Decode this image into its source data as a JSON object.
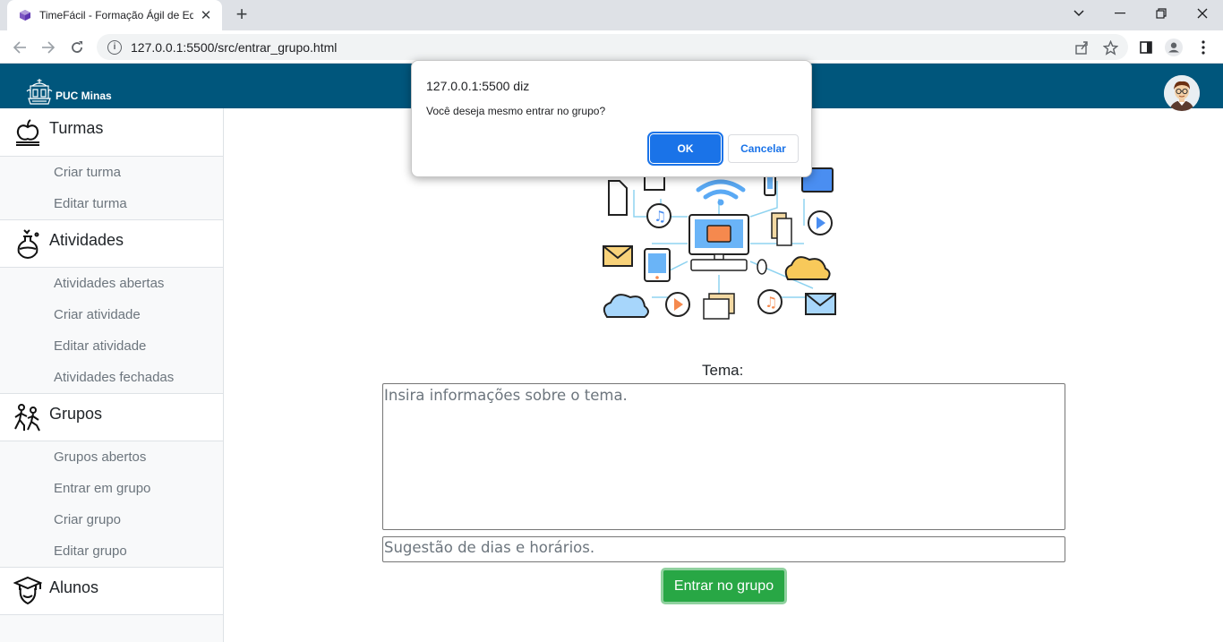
{
  "browser": {
    "tab_title": "TimeFácil - Formação Ágil de Equ",
    "url": "127.0.0.1:5500/src/entrar_grupo.html"
  },
  "header": {
    "brand": "PUC Minas",
    "bg_color": "#00567c"
  },
  "sidebar": {
    "sections": [
      {
        "label": "Turmas",
        "icon": "apple-icon",
        "items": [
          "Criar turma",
          "Editar turma"
        ]
      },
      {
        "label": "Atividades",
        "icon": "flask-icon",
        "items": [
          "Atividades abertas",
          "Criar atividade",
          "Editar atividade",
          "Atividades fechadas"
        ]
      },
      {
        "label": "Grupos",
        "icon": "people-icon",
        "items": [
          "Grupos abertos",
          "Entrar em grupo",
          "Criar grupo",
          "Editar grupo"
        ]
      },
      {
        "label": "Alunos",
        "icon": "student-icon",
        "items": []
      }
    ]
  },
  "form": {
    "tema_label": "Tema:",
    "tema_placeholder": "Insira informações sobre o tema.",
    "sugestao_placeholder": "Sugestão de dias e horários.",
    "submit_label": "Entrar no grupo",
    "submit_color": "#28a745"
  },
  "dialog": {
    "title": "127.0.0.1:5500 diz",
    "message": "Você deseja mesmo entrar no grupo?",
    "ok_label": "OK",
    "cancel_label": "Cancelar",
    "accent": "#1a73e8"
  }
}
